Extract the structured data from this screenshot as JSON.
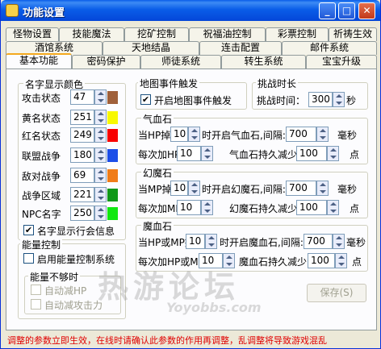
{
  "window": {
    "title": "功能设置"
  },
  "tabs": {
    "row1": [
      "怪物设置",
      "技能魔法",
      "挖矿控制",
      "祝福油控制",
      "彩票控制",
      "祈祷生效"
    ],
    "row2": [
      "酒馆系统",
      "天地结晶",
      "连击配置",
      "邮件系统"
    ],
    "row3": [
      "基本功能",
      "密码保护",
      "师徒系统",
      "转生系统",
      "宝宝升级"
    ],
    "active": "基本功能"
  },
  "name_color": {
    "title": "名字显示颜色",
    "items": [
      {
        "label": "攻击状态",
        "value": "47",
        "color": "#a0603a"
      },
      {
        "label": "黄名状态",
        "value": "251",
        "color": "#f8f800"
      },
      {
        "label": "红名状态",
        "value": "249",
        "color": "#f80000"
      },
      {
        "label": "联盟战争",
        "value": "180",
        "color": "#1c4ee8"
      },
      {
        "label": "敌对战争",
        "value": "69",
        "color": "#f07c18"
      },
      {
        "label": "战争区域",
        "value": "221",
        "color": "#109818"
      },
      {
        "label": "NPC名字",
        "value": "250",
        "color": "#10e810"
      }
    ],
    "multiline_label": "名字显示行会信息"
  },
  "map_event": {
    "title": "地图事件触发",
    "enable_label": "开启地图事件触发"
  },
  "challenge": {
    "title": "挑战时长",
    "time_label": "挑战时间：",
    "time_value": "300",
    "unit": "秒"
  },
  "hp_stone": {
    "title": "气血石",
    "line1_a": "当HP掉",
    "line1_val": "10",
    "line1_b": "时开启气血石,间隔:",
    "interval": "700",
    "interval_unit": "毫秒",
    "line2_a": "每次加HP",
    "add_val": "10",
    "line2_b": "气血石持久减少",
    "reduce_val": "100",
    "point_unit": "点"
  },
  "mp_stone": {
    "title": "幻魔石",
    "line1_a": "当MP掉",
    "line1_val": "10",
    "line1_b": "时开启幻魔石,间隔:",
    "interval": "700",
    "interval_unit": "毫秒",
    "line2_a": "每次加MP",
    "add_val": "10",
    "line2_b": "幻魔石持久减少",
    "reduce_val": "100",
    "point_unit": "点"
  },
  "magic_stone": {
    "title": "魔血石",
    "line1_a": "当HP或MP掉",
    "line1_val": "10",
    "line1_b": "时开启魔血石,间隔:",
    "interval": "700",
    "interval_unit": "毫秒",
    "line2_a": "每次加HP或MP",
    "add_val": "10",
    "line2_b": "魔血石持久减少",
    "reduce_val": "100",
    "point_unit": "点"
  },
  "energy": {
    "title": "能量控制",
    "enable_label": "启用能量控制系统",
    "insufficient_title": "能量不够时",
    "auto_hp_label": "自动减HP",
    "auto_attack_label": "自动减攻击力"
  },
  "save_label": "保存(S)",
  "footer": "调整的参数立即生效，在线时请确认此参数的作用再调整，乱调整将导致游戏混乱",
  "watermark": {
    "main": "热游论坛",
    "sub": "Yoyobbs.com"
  }
}
